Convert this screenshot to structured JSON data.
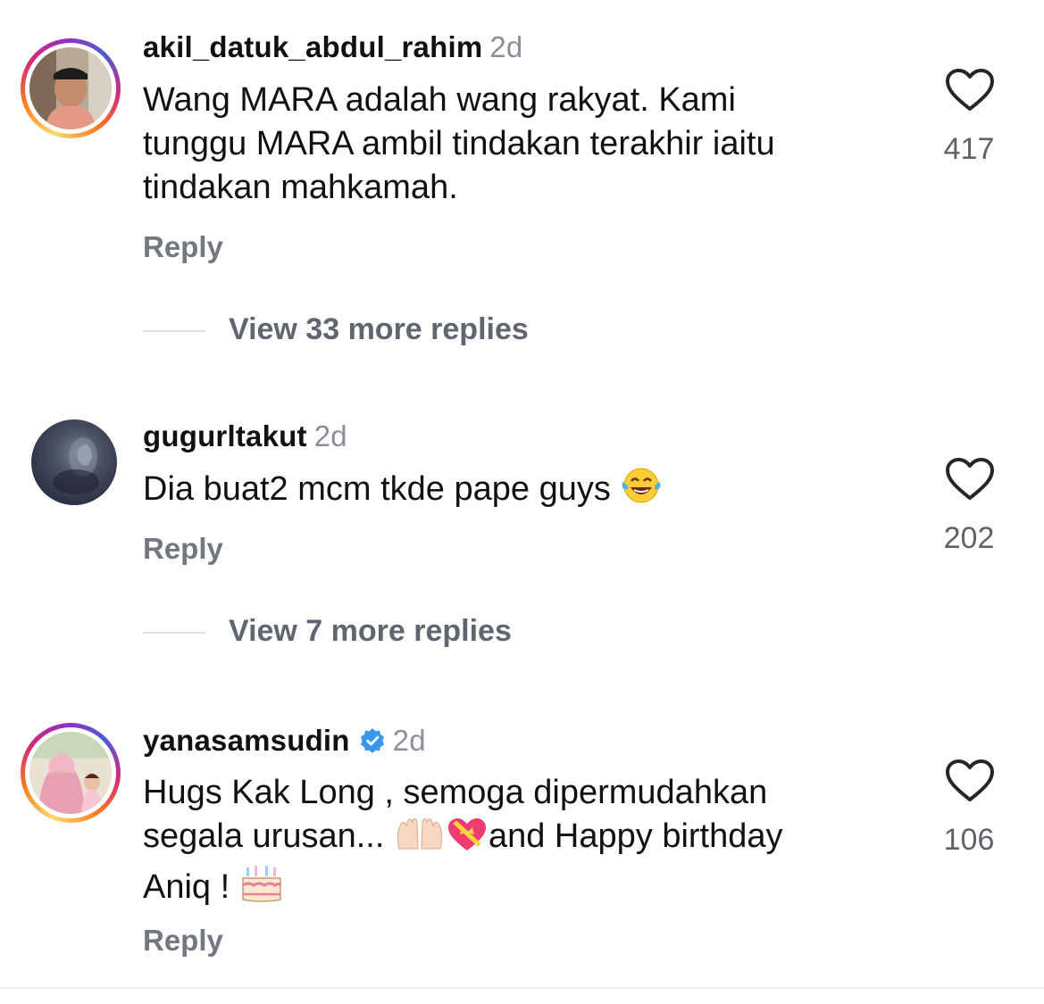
{
  "comments": [
    {
      "username": "akil_datuk_abdul_rahim",
      "time": "2d",
      "lines": [
        "Wang MARA adalah wang rakyat. Kami",
        "tunggu MARA ambil tindakan terakhir iaitu",
        "tindakan mahkamah."
      ],
      "reply_label": "Reply",
      "likes": "417",
      "view_replies": "View 33 more replies",
      "has_story_ring": true,
      "verified": false
    },
    {
      "username": "gugurltakut",
      "time": "2d",
      "lines": [
        "Dia buat2 mcm tkde pape guys"
      ],
      "reply_label": "Reply",
      "likes": "202",
      "view_replies": "View 7 more replies",
      "has_story_ring": false,
      "verified": false
    },
    {
      "username": "yanasamsudin",
      "time": "2d",
      "lines": [
        "Hugs Kak Long , semoga dipermudahkan",
        "segala urusan... ",
        "and Happy birthday",
        "Aniq ! "
      ],
      "reply_label": "Reply",
      "likes": "106",
      "has_story_ring": true,
      "verified": true
    }
  ],
  "icons": {
    "heart": "heart-outline-icon",
    "verified": "verified-badge-icon",
    "laugh": "face-with-tears-of-joy-emoji",
    "hands": "raised-hands-emoji",
    "heart_gift": "heart-with-ribbon-emoji",
    "cake": "birthday-cake-emoji"
  },
  "colors": {
    "text": "#111111",
    "muted": "#8a8f98",
    "reply": "#737880",
    "verified": "#3897f0",
    "heart_stroke": "#262626"
  }
}
